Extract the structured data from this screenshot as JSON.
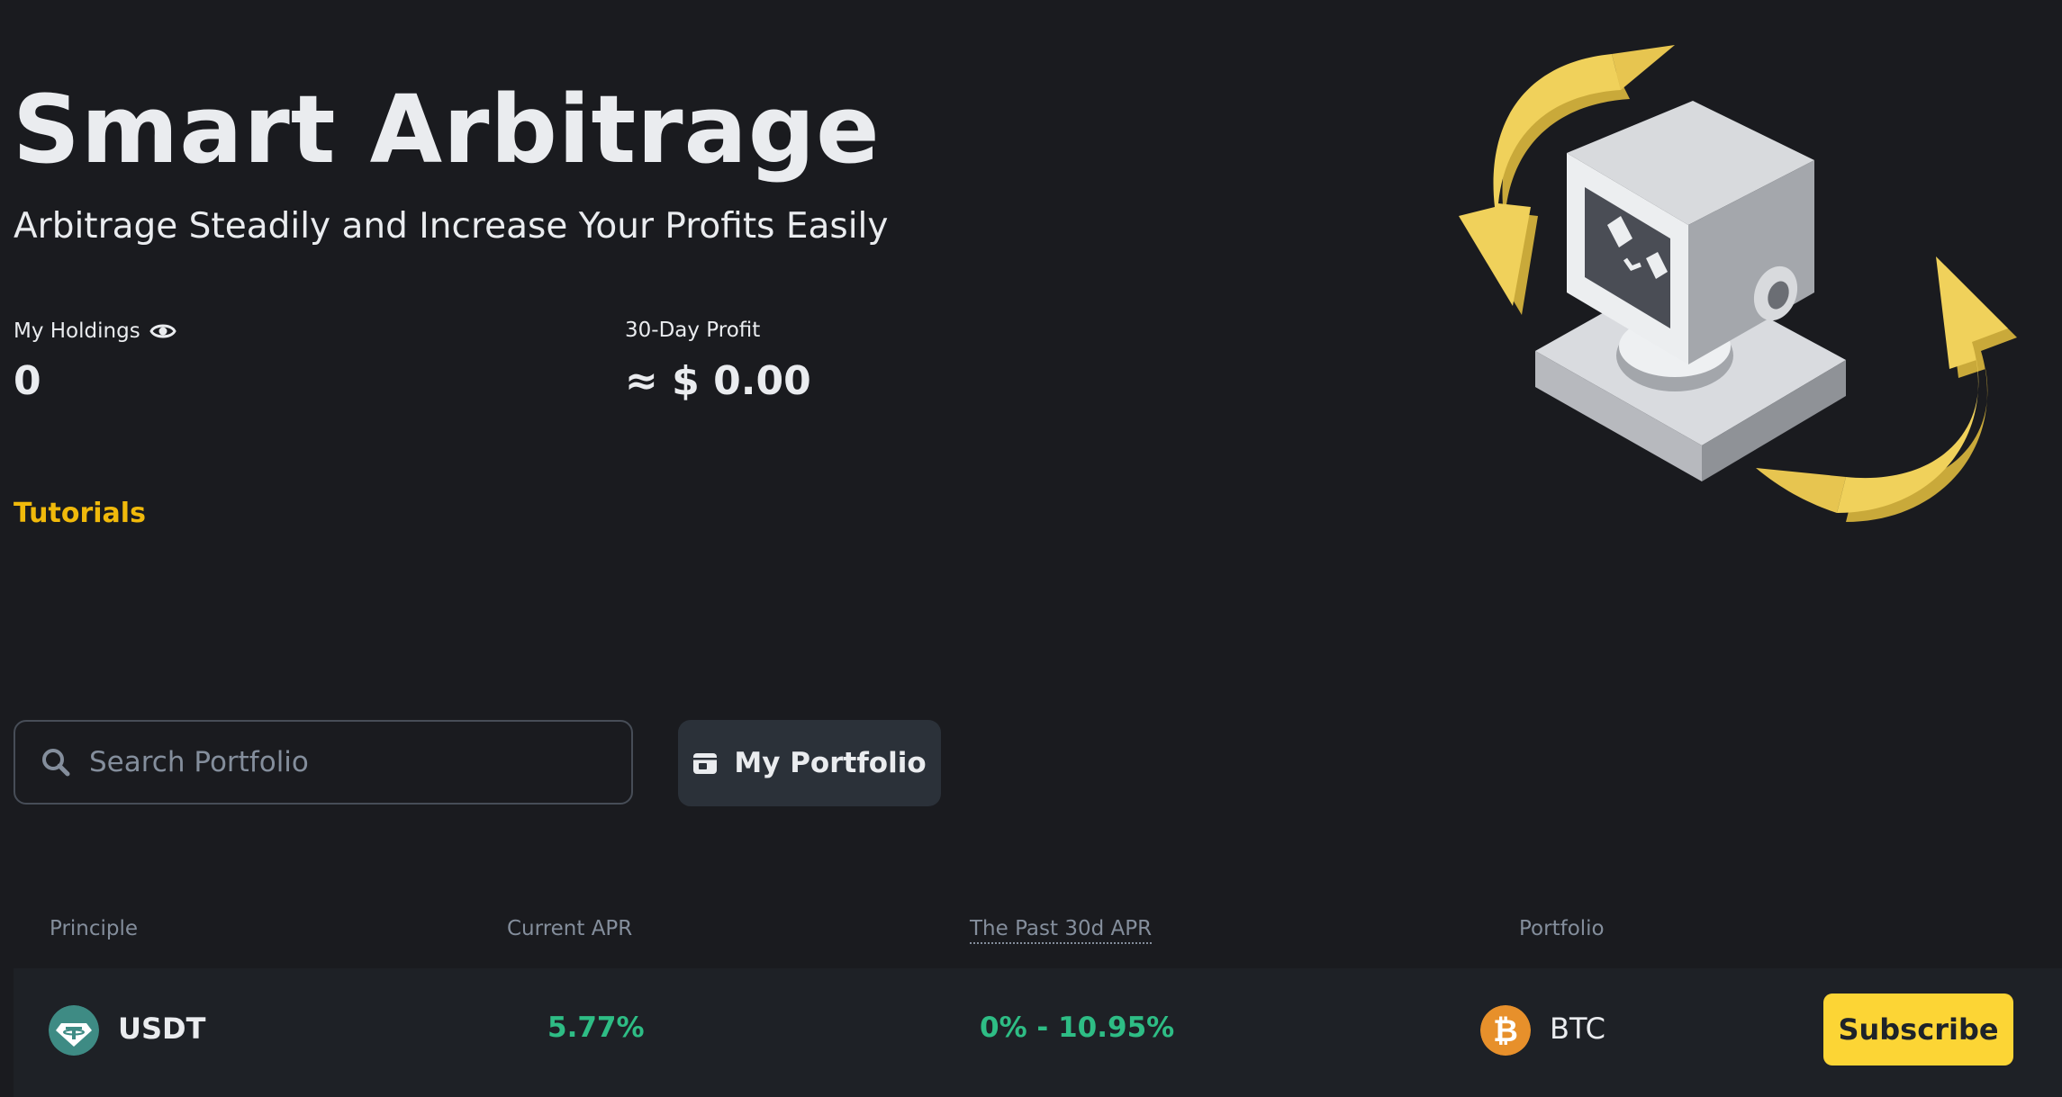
{
  "header": {
    "title": "Smart Arbitrage",
    "subtitle": "Arbitrage Steadily and Increase Your Profits Easily"
  },
  "stats": {
    "holdings_label": "My Holdings",
    "holdings_value": "0",
    "profit_label": "30-Day Profit",
    "profit_value": "≈ $ 0.00"
  },
  "links": {
    "tutorials": "Tutorials"
  },
  "search": {
    "placeholder": "Search Portfolio",
    "value": ""
  },
  "buttons": {
    "my_portfolio": "My Portfolio",
    "subscribe": "Subscribe"
  },
  "table": {
    "headers": {
      "principle": "Principle",
      "current_apr": "Current APR",
      "past_30d_apr": "The Past 30d APR",
      "portfolio": "Portfolio"
    },
    "rows": [
      {
        "principle": "USDT",
        "current_apr": "5.77%",
        "past_30d_apr": "0% - 10.95%",
        "portfolio": "BTC"
      }
    ]
  },
  "icons": {
    "holdings_visibility": "eye-icon",
    "search": "search-icon",
    "portfolio": "wallet-icon",
    "usdt": "tether-coin-icon",
    "btc": "bitcoin-coin-icon"
  },
  "colors": {
    "background": "#1a1b1f",
    "accent": "#f0b90b",
    "button_primary": "#fcd535",
    "positive": "#2ebd85",
    "muted": "#848e9c",
    "row_bg": "#1e2126",
    "usdt": "#26a17b",
    "btc": "#f7931a"
  }
}
